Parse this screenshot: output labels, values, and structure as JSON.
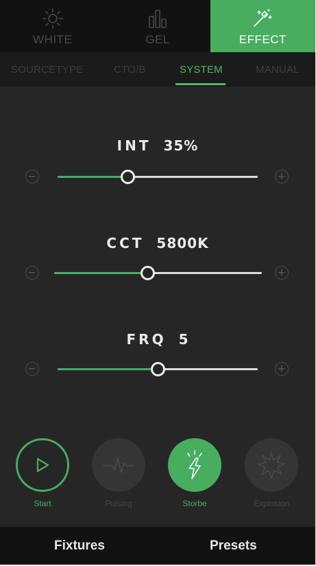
{
  "modes": [
    {
      "label": "WHITE",
      "icon": "sun-icon"
    },
    {
      "label": "GEL",
      "icon": "bars-icon"
    },
    {
      "label": "EFFECT",
      "icon": "magic-wand-icon",
      "active": true
    }
  ],
  "subtabs": [
    {
      "label": "SOURCETYPE"
    },
    {
      "label": "CTO/B"
    },
    {
      "label": "SYSTEM",
      "active": true
    },
    {
      "label": "MANUAL"
    }
  ],
  "sliders": [
    {
      "name": "INT",
      "value_label": "35%",
      "position": 0.35
    },
    {
      "name": "CCT",
      "value_label": "5800K",
      "position": 0.45
    },
    {
      "name": "FRQ",
      "value_label": "5",
      "position": 0.5
    }
  ],
  "effects": [
    {
      "label": "Start",
      "icon": "play-icon",
      "state": "start"
    },
    {
      "label": "Pulsing",
      "icon": "pulse-icon",
      "state": "inactive"
    },
    {
      "label": "Storbe",
      "icon": "lightning-icon",
      "state": "active"
    },
    {
      "label": "Explosion",
      "icon": "explosion-icon",
      "state": "inactive"
    }
  ],
  "bottom_nav": {
    "fixtures": "Fixtures",
    "presets": "Presets"
  },
  "colors": {
    "accent": "#48ad5f",
    "background": "#262626",
    "bar": "#121212"
  }
}
